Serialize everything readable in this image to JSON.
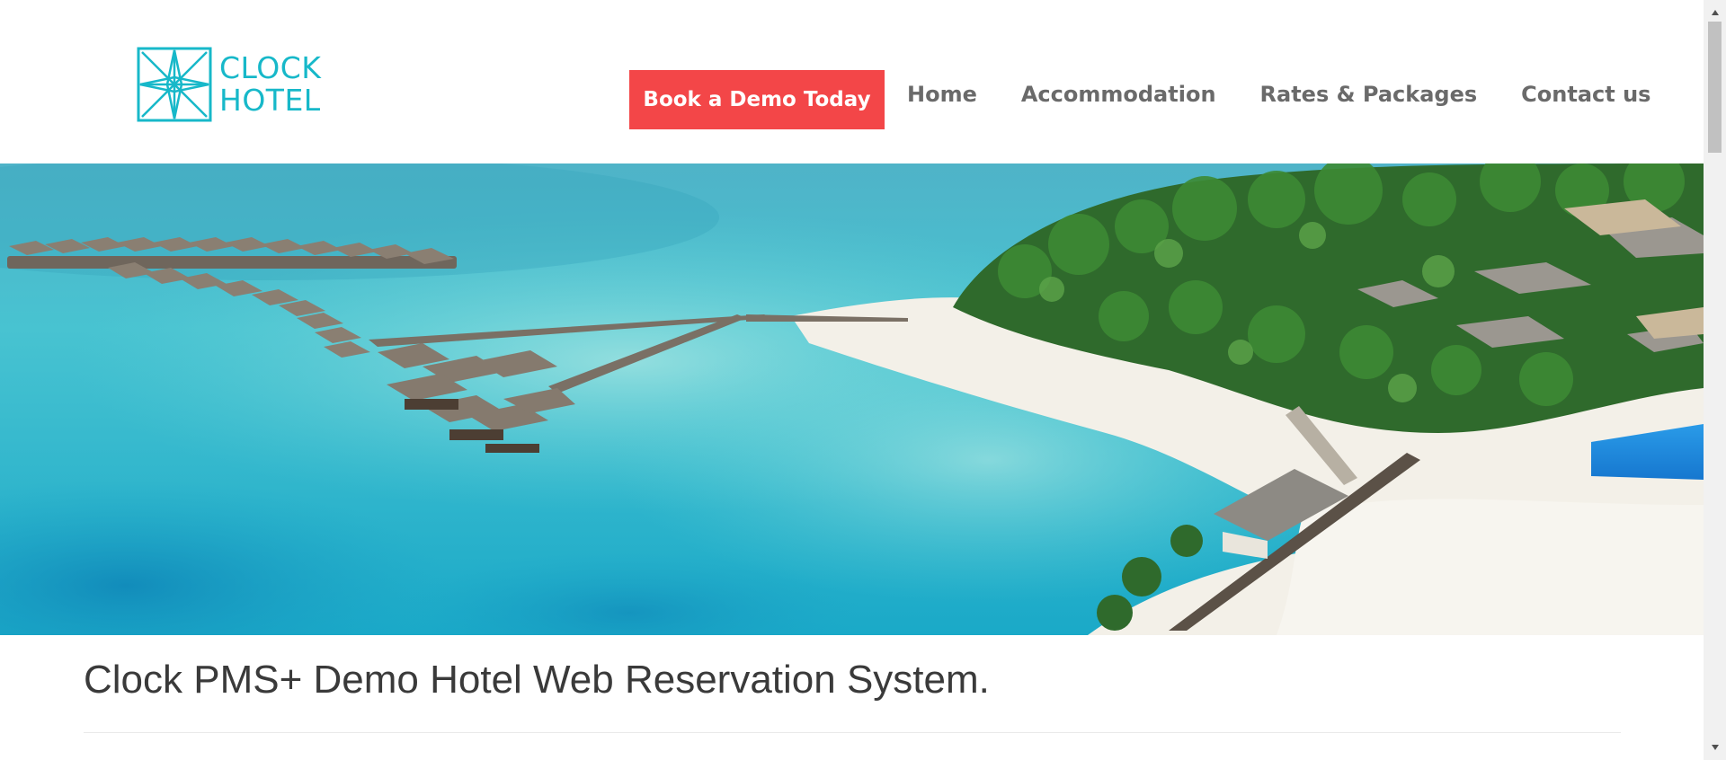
{
  "logo": {
    "line1": "CLOCK",
    "line2": "HOTEL",
    "color": "#17b8c9"
  },
  "nav": {
    "cta_label": "Book a Demo Today",
    "cta_color": "#f34648",
    "items": [
      {
        "label": "Home"
      },
      {
        "label": "Accommodation"
      },
      {
        "label": "Rates & Packages"
      },
      {
        "label": "Contact us"
      }
    ]
  },
  "main": {
    "title": "Clock PMS+ Demo Hotel Web Reservation System."
  },
  "scrollbar": {
    "up_icon": "chevron-up-icon",
    "down_icon": "chevron-down-icon"
  }
}
